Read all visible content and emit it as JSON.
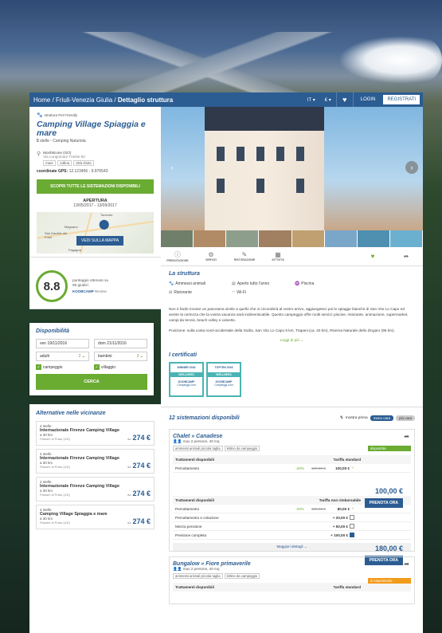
{
  "nav": {
    "home": "Home",
    "sep1": "/",
    "region": "Friuli-Venezia Giulia",
    "sep2": "/",
    "current": "Dettaglio struttura",
    "lang": "IT ▾",
    "currency": "€ ▾",
    "login": "LOGIN",
    "register": "REGISTRATI"
  },
  "property": {
    "pet": "struttura Pet Friendly",
    "name": "Camping Village Spiaggia e mare",
    "stars": "5",
    "stars_text": "stelle - Camping Naturista",
    "city": "Monfalcone (GO)",
    "address": "Via Lungomare Trieste 90",
    "tags": [
      "mare",
      "collina",
      "città d'arte"
    ],
    "gps_label": "coordinate GPS:",
    "gps": "12.123456 - 9.876543",
    "discover": "SCOPRI TUTTE LE SISTEMAZIONI DISPONIBILI",
    "apertura": "APERTURA",
    "dates": "13/05/2017 - 13/09/2017",
    "map_btn": "VEDI SULLA MAPPA",
    "map_labels": [
      "Torcento",
      "Magnano",
      "San Daniele del Friuli",
      "Fagagna"
    ]
  },
  "score": {
    "value": "8.8",
    "line1": "punteggio ottenuto su",
    "line2": "96 giudizi",
    "brand": "KOOBCAMP",
    "brand2": "Review"
  },
  "avail": {
    "title": "Disponibilità",
    "from": "ven 19/11/2016",
    "to": "dom 21/11/2016",
    "adults": "adulti",
    "adults_n": "2",
    "children": "bambini",
    "children_n": "3",
    "camping": "campeggio",
    "village": "villaggio",
    "search": "CERCA"
  },
  "alternatives": {
    "title": "Alternative nelle vicinanze",
    "items": [
      {
        "stars": "4 stelle",
        "name": "Internazionale Firenze Camping Village",
        "km": "a 30 km",
        "from": "Passeri di Prato (UD)",
        "pfx": "da",
        "price": "274 €"
      },
      {
        "stars": "4 stelle",
        "name": "Internazionale Firenze Camping Village",
        "km": "a 30 km",
        "from": "Passeri di Prato (UD)",
        "pfx": "da",
        "price": "274 €"
      },
      {
        "stars": "2 stelle",
        "name": "Internazionale Firenze Camping Village",
        "km": "a 30 km",
        "from": "Passeri di Prato (UD)",
        "pfx": "da",
        "price": "274 €"
      },
      {
        "stars": "4 stelle",
        "name": "Camping Village Spiaggia e mare",
        "km": "a 30 km",
        "from": "Passeri di Prato (UD)",
        "pfx": "da",
        "price": "274 €"
      }
    ]
  },
  "icons": [
    "PRENOTAZIONE",
    "SERVIZI",
    "RISTORAZIONE",
    "ATTIVITÀ",
    "SPIAGGE"
  ],
  "structure": {
    "title": "La struttura",
    "amenities": [
      "Ammessi animali",
      "Aperto tutto l'anno",
      "Piscina",
      "Ristorante",
      "Wi-Fi"
    ],
    "desc1": "Non è facile trovare un panorama simile a quello che vi circonderà al vostro arrivo, aggiungeteci poi le spiagge bianche di San Vito Lo Capo ed avrete la certezza che la vostra vacanza sarà indimenticabile. Questo campeggio offre molti servizi: piscine, ristorante, animazione, supermarket, campi da tennis, beach volley e calcetto.",
    "desc2": "Posizione: sulla costa nord-occidentale della Sicilia, San Vito Lo Capo 5 km, Trapani (ca. 40 km), Riserva Naturale dello Zingaro (95 km).",
    "more": "Leggi di più"
  },
  "cert": {
    "title": "I certificati",
    "b1": "WINNER 2016",
    "b2": "TOPTEN 2016",
    "w": "WELLNESS",
    "brand": "KOOBCAMP",
    "site": "Campeggi.com"
  },
  "sist": {
    "title": "12 sistemazioni disponibili",
    "sort": "mostra prima",
    "s1": "meno cara",
    "s2": "più cara"
  },
  "acc1": {
    "name": "Chalet » Canadese",
    "sub": "max 2 persone, 40 mq",
    "tags": [
      "ammessi animali piccola taglia",
      "lettino da campeggio"
    ],
    "status": "disponibile",
    "h1": "Trattamenti disponibili",
    "h2": "Tariffa standard",
    "l1": "Pernottamento",
    "pct": "-20%",
    "old": "120,00 €",
    "p1": "100,00 €",
    "total": "100,00 €",
    "book": "PRENOTA ORA",
    "h3": "Trattamenti disponibili",
    "h4": "Tariffa non rimborsabile",
    "r1": [
      "Pernottamento",
      "-20%",
      "100,00 €",
      "80,00 €"
    ],
    "r2": [
      "Pernottamento e colazione",
      "+ 20,00 €"
    ],
    "r3": [
      "Mezza pensione",
      "+ 50,00 €"
    ],
    "r4": [
      "Pensione completa",
      "+ 100,00 €"
    ],
    "total2": "180,00 €",
    "more": "Maggiori dettagli"
  },
  "acc2": {
    "name": "Bungalow » Fiore primaverile",
    "sub": "max 2 persone, 40 mq",
    "tags": [
      "ammessi animali piccola taglia",
      "lettino da campeggio"
    ],
    "status": "in esaurimento",
    "h1": "Trattamenti disponibili",
    "h2": "Tariffa standard"
  },
  "colors": {
    "blue": "#2b5c92",
    "green": "#6aab32",
    "orange": "#f29a1a"
  }
}
